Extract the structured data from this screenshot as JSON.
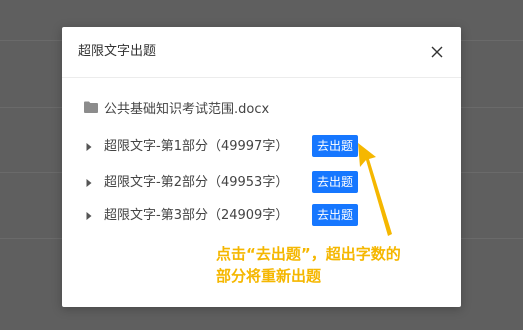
{
  "dialog": {
    "title": "超限文字出题",
    "close_icon": "close-icon"
  },
  "file": {
    "icon": "folder-icon",
    "name": "公共基础知识考试范围.docx"
  },
  "parts": [
    {
      "label": "超限文字-第1部分（49997字）",
      "button": "去出题"
    },
    {
      "label": "超限文字-第2部分（49953字）",
      "button": "去出题"
    },
    {
      "label": "超限文字-第3部分（24909字）",
      "button": "去出题"
    }
  ],
  "annotation": {
    "line1": "点击“去出题”，超出字数的",
    "line2": "部分将重新出题",
    "color": "#f5b700"
  },
  "colors": {
    "primary": "#1677ff",
    "overlay": "#5f5f5f"
  }
}
